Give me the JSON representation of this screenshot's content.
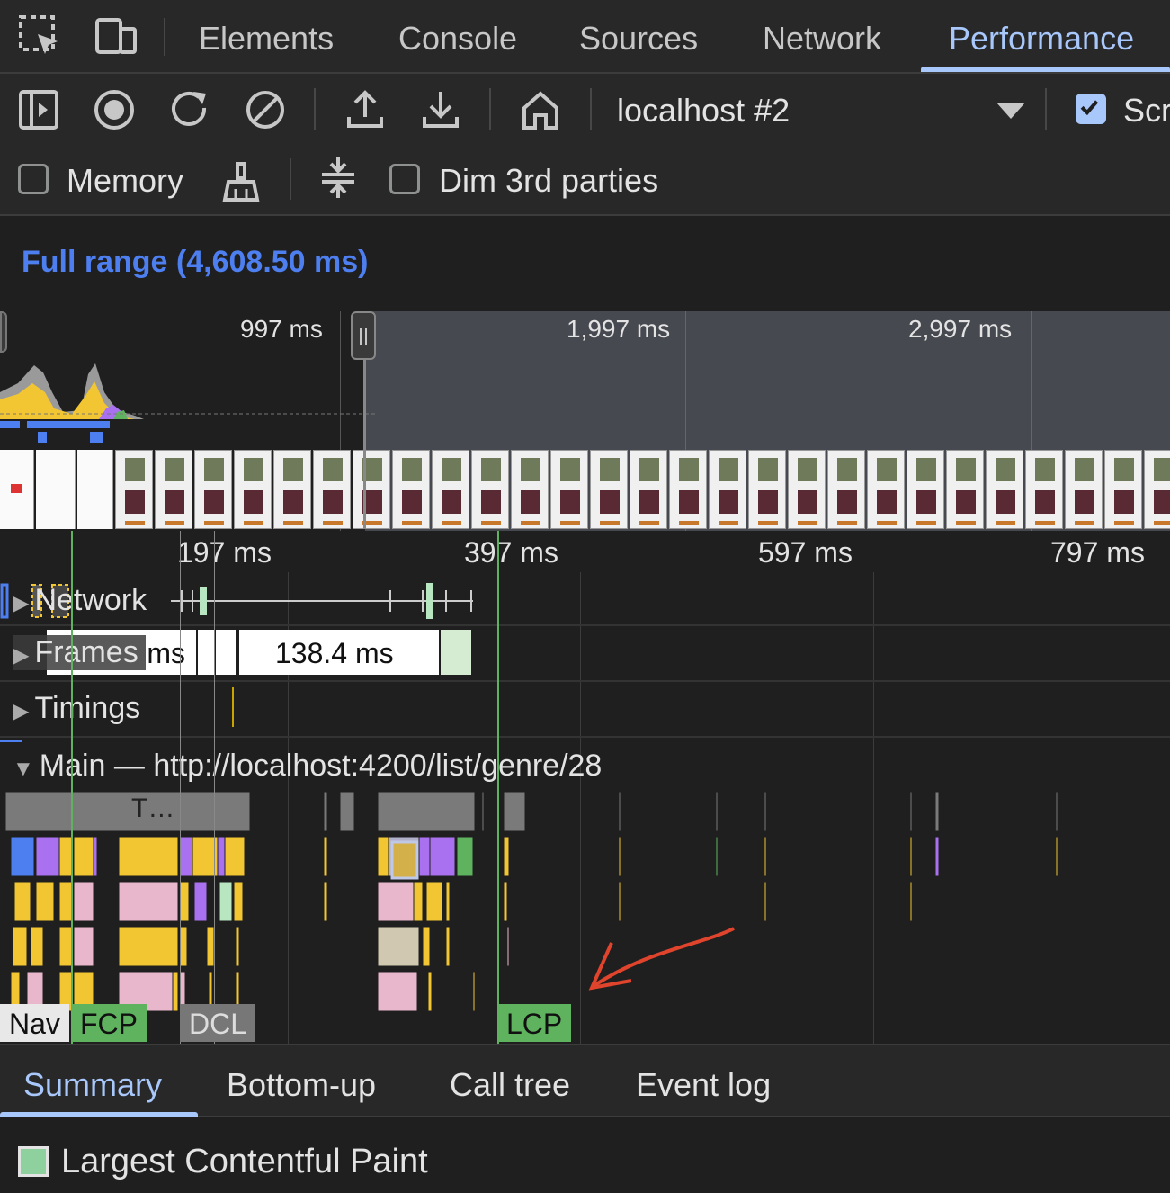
{
  "tabbar": {
    "tabs": [
      {
        "label": "Elements"
      },
      {
        "label": "Console"
      },
      {
        "label": "Sources"
      },
      {
        "label": "Network"
      },
      {
        "label": "Performance"
      }
    ],
    "active_tab": "Performance"
  },
  "toolbar": {
    "target": "localhost #2",
    "screenshots_label": "Scr",
    "screenshots_checked": true,
    "memory_label": "Memory",
    "memory_checked": false,
    "dim_label": "Dim 3rd parties",
    "dim_checked": false
  },
  "range": {
    "title": "Full range (4,608.50 ms)"
  },
  "overview": {
    "time_labels": [
      "997 ms",
      "1,997 ms",
      "2,997 ms"
    ]
  },
  "flame": {
    "ruler_labels": [
      "197 ms",
      "397 ms",
      "597 ms",
      "797 ms"
    ],
    "tracks": {
      "network": "Network",
      "frames": "Frames",
      "timings": "Timings",
      "main": "Main — http://localhost:4200/list/genre/28"
    },
    "frame_label_partial": "ms",
    "frame_duration": "138.4 ms",
    "task_label": "T…",
    "markers": {
      "nav": "Nav",
      "fcp": "FCP",
      "dcl": "DCL",
      "lcp": "LCP"
    },
    "colors": {
      "scripting": "#f2c632",
      "rendering": "#a970f0",
      "painting": "#5fb35f",
      "system": "#7a7a7a",
      "lcp": "#5fb35f",
      "dcl": "#777777",
      "annotation_arrow": "#e0442c",
      "accent": "#a8c7fa"
    }
  },
  "bottom_tabs": {
    "tabs": [
      {
        "label": "Summary"
      },
      {
        "label": "Bottom-up"
      },
      {
        "label": "Call tree"
      },
      {
        "label": "Event log"
      }
    ],
    "active_tab": "Summary"
  },
  "summary": {
    "title": "Largest Contentful Paint"
  }
}
